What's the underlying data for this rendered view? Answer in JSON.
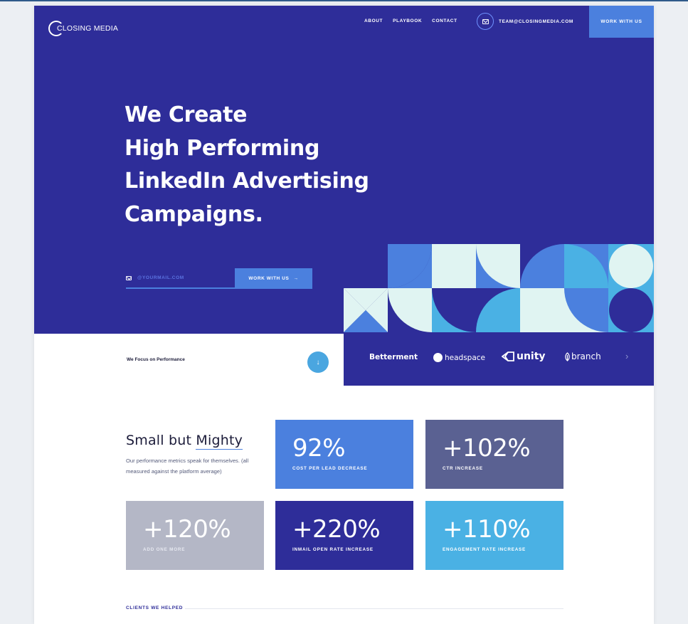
{
  "header": {
    "logo_text": "CLOSING MEDIA",
    "nav": [
      "ABOUT",
      "PLAYBOOK",
      "CONTACT"
    ],
    "email": "TEAM@CLOSINGMEDIA.COM",
    "cta": "WORK WITH US"
  },
  "hero": {
    "headline": [
      "We Create",
      "High Performing",
      "LinkedIn Advertising",
      "Campaigns."
    ],
    "email_placeholder": "@YOURMAIL.COM",
    "button_label": "WORK WITH US"
  },
  "focus": {
    "text": "We Focus on Performance",
    "down_icon": "↓"
  },
  "client_logos": {
    "betterment": "Betterment",
    "headspace": "headspace",
    "unity": "unity",
    "branch": "branch",
    "next_icon": "›"
  },
  "stats_section": {
    "title_pre": "Small but ",
    "title_em": "Mighty",
    "subtitle": "Our performance metrics speak for themselves. (all measured against the platform average)",
    "stats": [
      {
        "value": "92%",
        "label": "COST PER LEAD DECREASE",
        "color": "#4b80de"
      },
      {
        "value": "+102%",
        "label": "CTR INCREASE",
        "color": "#5a6192"
      },
      {
        "value": "+120%",
        "label": "ADD ONE MORE",
        "color": "#b4b7c6"
      },
      {
        "value": "+220%",
        "label": "INMAIL OPEN RATE INCREASE",
        "color": "#2e2d99"
      },
      {
        "value": "+110%",
        "label": "ENGAGEMENT RATE INCREASE",
        "color": "#4ab1e4"
      }
    ]
  },
  "clients": {
    "label": "CLIENTS WE HELPED"
  },
  "colors": {
    "hero_bg": "#2e2d99",
    "accent_blue": "#4b80de",
    "sky": "#4ab1e4",
    "mint": "#e0f4f2"
  }
}
